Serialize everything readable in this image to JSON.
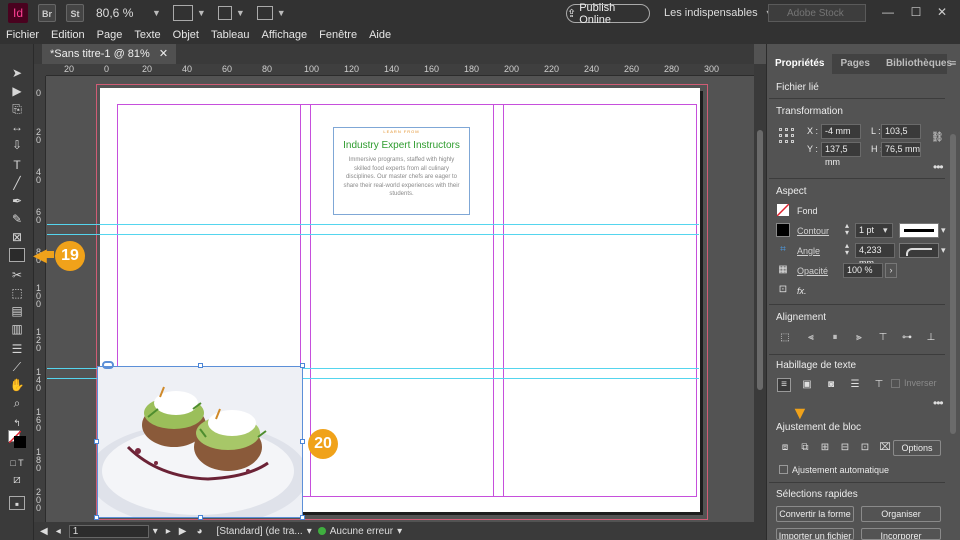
{
  "app": {
    "logo": "Id",
    "icons": [
      "Br",
      "St"
    ],
    "zoom": "80,6 %",
    "publish_label": "Publish Online",
    "workspace": "Les indispensables",
    "search_placeholder": "Adobe Stock"
  },
  "menu": [
    "Fichier",
    "Edition",
    "Page",
    "Texte",
    "Objet",
    "Tableau",
    "Affichage",
    "Fenêtre",
    "Aide"
  ],
  "document_tab": "*Sans titre-1 @ 81%",
  "rulers": {
    "horizontal": [
      "20",
      "0",
      "20",
      "40",
      "60",
      "80",
      "100",
      "120",
      "140",
      "160",
      "180",
      "200",
      "220",
      "240",
      "260",
      "280",
      "300"
    ],
    "vertical": [
      "0",
      "2 0",
      "4 0",
      "6 0",
      "8 0",
      "1 0 0",
      "1 2 0",
      "1 4 0",
      "1 6 0",
      "1 8 0",
      "2 0 0"
    ]
  },
  "textframe": {
    "kicker": "LEARN FROM",
    "title": "Industry Expert Instructors",
    "body": "Immersive programs, staffed with highly skilled food experts from all culinary disciplines. Our master chefs are eager to share their real-world experiences with their students."
  },
  "callouts": [
    "19",
    "20"
  ],
  "status": {
    "page": "1",
    "style": "[Standard] (de tra...",
    "errors": "Aucune erreur"
  },
  "panel": {
    "tabs": [
      "Propriétés",
      "Pages",
      "Bibliothèques"
    ],
    "linked_file": "Fichier lié",
    "transformation": {
      "title": "Transformation",
      "x_label": "X :",
      "x": "-4 mm",
      "y_label": "Y :",
      "y": "137,5 mm",
      "l_label": "L :",
      "l": "103,5 mm",
      "h_label": "H :",
      "h": "76,5 mm"
    },
    "aspect": {
      "title": "Aspect",
      "fill": "Fond",
      "stroke": "Contour",
      "stroke_value": "1 pt",
      "corner": "Angle",
      "corner_value": "4,233 mm",
      "opacity": "Opacité",
      "opacity_value": "100 %",
      "fx": "fx."
    },
    "alignment": "Alignement",
    "text_wrap": {
      "title": "Habillage de texte",
      "invert": "Inverser"
    },
    "fitting": {
      "title": "Ajustement de bloc",
      "options": "Options",
      "auto": "Ajustement automatique"
    },
    "quick": {
      "title": "Sélections rapides",
      "convert": "Convertir la forme",
      "arrange": "Organiser",
      "import": "Importer un fichier",
      "embed": "Incorporer"
    }
  },
  "colors": {
    "accent": "#f0a21a",
    "margin": "#c64fdc",
    "guide": "#55d5ee",
    "title_green": "#2e9c2e"
  }
}
